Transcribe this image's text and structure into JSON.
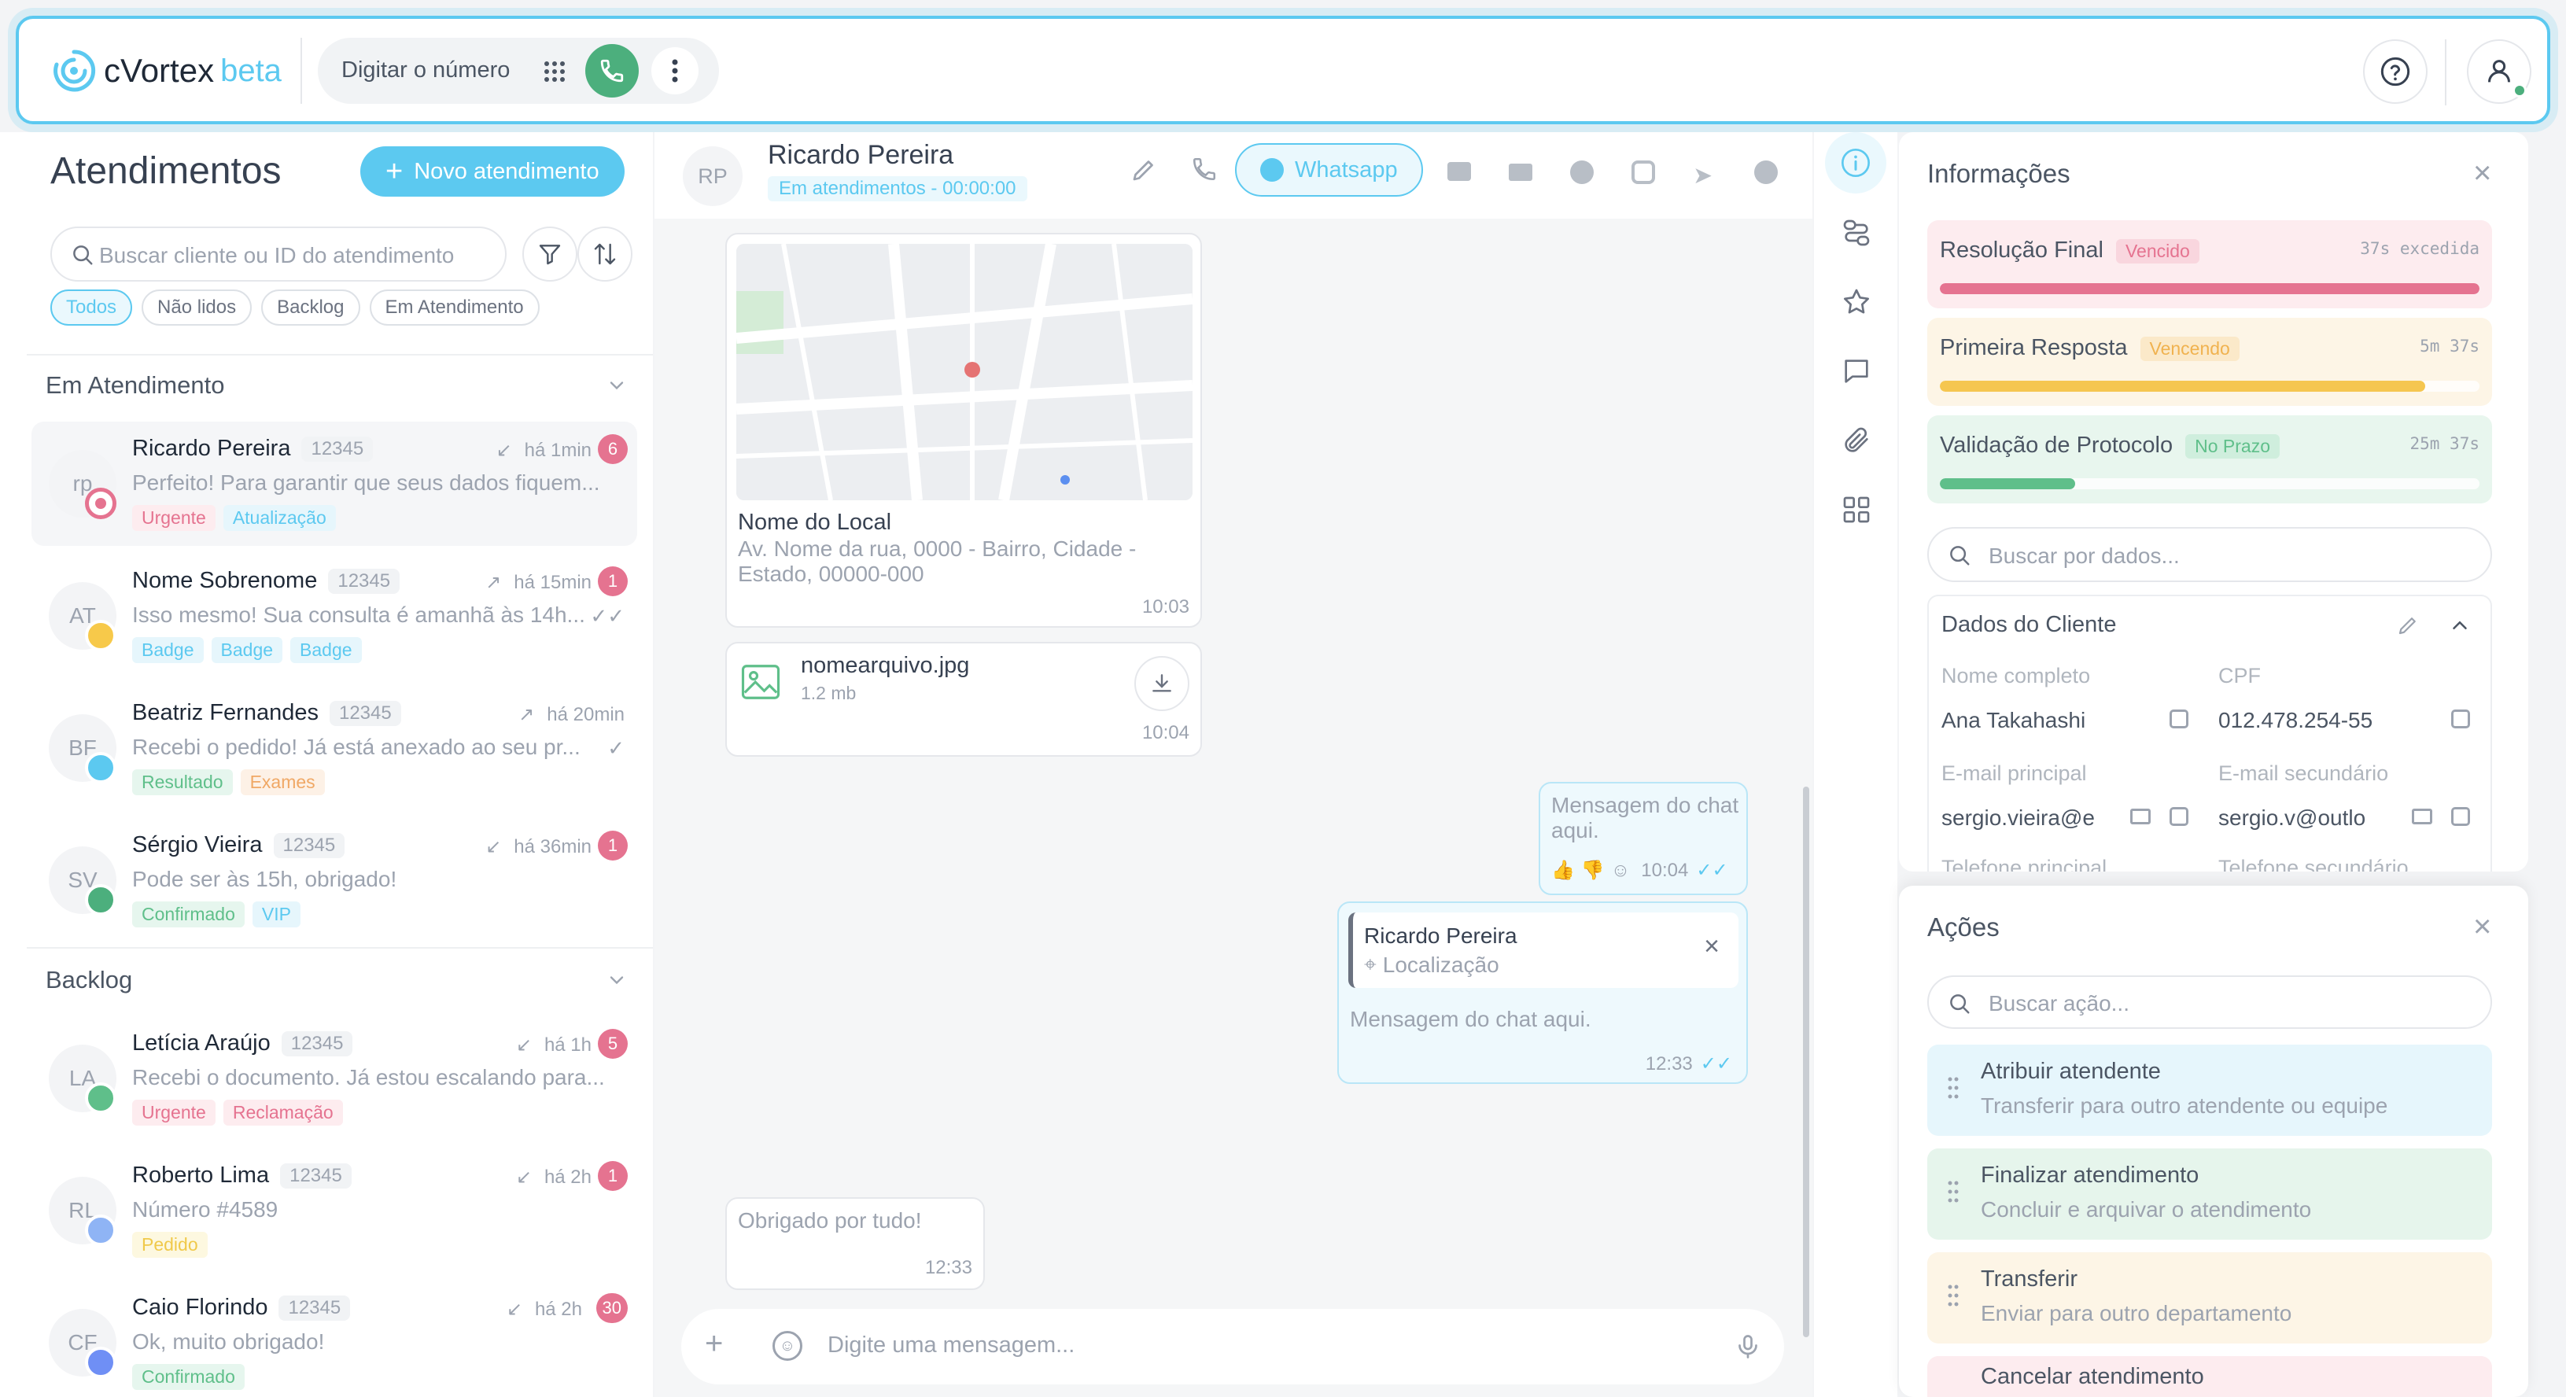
{
  "header": {
    "brand": "cVortex",
    "brand_suffix": "beta",
    "dial_placeholder": "Digitar o número"
  },
  "list": {
    "title": "Atendimentos",
    "new_button": "Novo atendimento",
    "search_placeholder": "Buscar cliente ou ID do atendimento",
    "filters": [
      "Todos",
      "Não lidos",
      "Backlog",
      "Em Atendimento"
    ],
    "section_active": "Em Atendimento",
    "section_backlog": "Backlog",
    "conversations": [
      {
        "initials": "rp",
        "name": "Ricardo Pereira",
        "id": "12345",
        "time": "há 1min",
        "count": "6",
        "msg": "Perfeito! Para garantir que seus dados fiquem...",
        "tags": [
          "Urgente",
          "Atualização"
        ]
      },
      {
        "initials": "AT",
        "name": "Nome Sobrenome",
        "id": "12345",
        "time": "há 15min",
        "count": "1",
        "msg": "Isso mesmo! Sua consulta é amanhã às 14h...",
        "tags": [
          "Badge",
          "Badge",
          "Badge"
        ]
      },
      {
        "initials": "BF",
        "name": "Beatriz Fernandes",
        "id": "12345",
        "time": "há 20min",
        "count": "",
        "msg": "Recebi o pedido! Já está anexado ao seu pr...",
        "tags": [
          "Resultado",
          "Exames"
        ]
      },
      {
        "initials": "SV",
        "name": "Sérgio Vieira",
        "id": "12345",
        "time": "há 36min",
        "count": "1",
        "msg": "Pode ser às 15h, obrigado!",
        "tags": [
          "Confirmado",
          "VIP"
        ]
      },
      {
        "initials": "LA",
        "name": "Letícia Araújo",
        "id": "12345",
        "time": "há 1h",
        "count": "5",
        "msg": "Recebi o documento. Já estou escalando para...",
        "tags": [
          "Urgente",
          "Reclamação"
        ]
      },
      {
        "initials": "RL",
        "name": "Roberto Lima",
        "id": "12345",
        "time": "há 2h",
        "count": "1",
        "msg": "Número #4589",
        "tags": [
          "Pedido"
        ]
      },
      {
        "initials": "CF",
        "name": "Caio Florindo",
        "id": "12345",
        "time": "há 2h",
        "count": "30",
        "msg": "Ok, muito obrigado!",
        "tags": [
          "Confirmado"
        ]
      }
    ]
  },
  "chat": {
    "initials": "RP",
    "name": "Ricardo Pereira",
    "status": "Em atendimentos - 00:00:00",
    "channel": "Whatsapp",
    "location_title": "Nome do Local",
    "location_address": "Av. Nome da rua, 0000 - Bairro, Cidade - Estado, 00000-000",
    "location_time": "10:03",
    "file_name": "nomearquivo.jpg",
    "file_size": "1.2 mb",
    "file_time": "10:04",
    "out1_text": "Mensagem do chat aqui.",
    "out1_time": "10:04",
    "reply_name": "Ricardo Pereira",
    "reply_sub": "Localização",
    "out2_text": "Mensagem do chat aqui.",
    "out2_time": "12:33",
    "in_text": "Obrigado por tudo!",
    "in_time": "12:33",
    "composer_placeholder": "Digite uma mensagem..."
  },
  "info": {
    "title": "Informações",
    "sla": [
      {
        "label": "Resolução Final",
        "status": "Vencido",
        "time": "37s excedida",
        "progress": 1.0
      },
      {
        "label": "Primeira Resposta",
        "status": "Vencendo",
        "time": "5m 37s",
        "progress": 0.9
      },
      {
        "label": "Validação de Protocolo",
        "status": "No Prazo",
        "time": "25m 37s",
        "progress": 0.25
      }
    ],
    "search_placeholder": "Buscar por dados...",
    "client_title": "Dados do Cliente",
    "fields": {
      "name_label": "Nome completo",
      "name_value": "Ana Takahashi",
      "cpf_label": "CPF",
      "cpf_value": "012.478.254-55",
      "email_label": "E-mail principal",
      "email_value": "sergio.vieira@e",
      "email2_label": "E-mail secundário",
      "email2_value": "sergio.v@outlo",
      "phone_label": "Telefone principal",
      "phone2_label": "Telefone secundário"
    }
  },
  "actions": {
    "title": "Ações",
    "search_placeholder": "Buscar ação...",
    "items": [
      {
        "title": "Atribuir atendente",
        "desc": "Transferir para outro atendente ou equipe"
      },
      {
        "title": "Finalizar atendimento",
        "desc": "Concluir e arquivar o atendimento"
      },
      {
        "title": "Transferir",
        "desc": "Enviar para outro departamento"
      },
      {
        "title": "Cancelar atendimento",
        "desc": ""
      }
    ]
  },
  "colors": {
    "accent": "#5cc9f0",
    "whatsapp": "#4caf7d",
    "danger": "#e57390"
  }
}
